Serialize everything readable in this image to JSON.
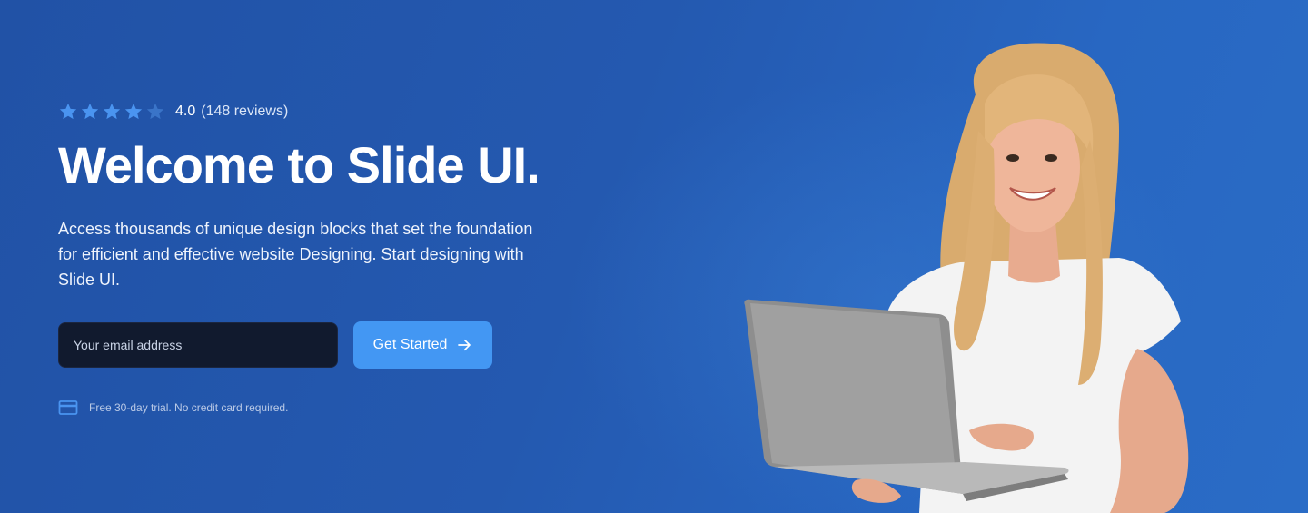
{
  "hero": {
    "rating": {
      "stars_filled": 4,
      "stars_total": 5,
      "star_icons": [
        "star-icon",
        "star-icon",
        "star-icon",
        "star-icon",
        "star-outline-icon"
      ],
      "value": "4.0",
      "count_text": "(148 reviews)"
    },
    "title": "Welcome to Slide UI.",
    "description": "Access thousands of unique design blocks that set the foundation for efficient and effective website Designing. Start designing with Slide UI.",
    "form": {
      "email_placeholder": "Your email address",
      "email_value": "",
      "cta_label": "Get Started",
      "cta_icon": "arrow-right-icon"
    },
    "trial": {
      "icon": "credit-card-icon",
      "text": "Free 30-day trial. No credit card required."
    },
    "image": {
      "subject": "smiling woman holding laptop"
    }
  },
  "colors": {
    "background": "#2459b0",
    "star": "#4a94f0",
    "star_empty": "#3a74c8",
    "cta": "#4397f3",
    "input": "#111a2e",
    "title": "#ffffff"
  }
}
